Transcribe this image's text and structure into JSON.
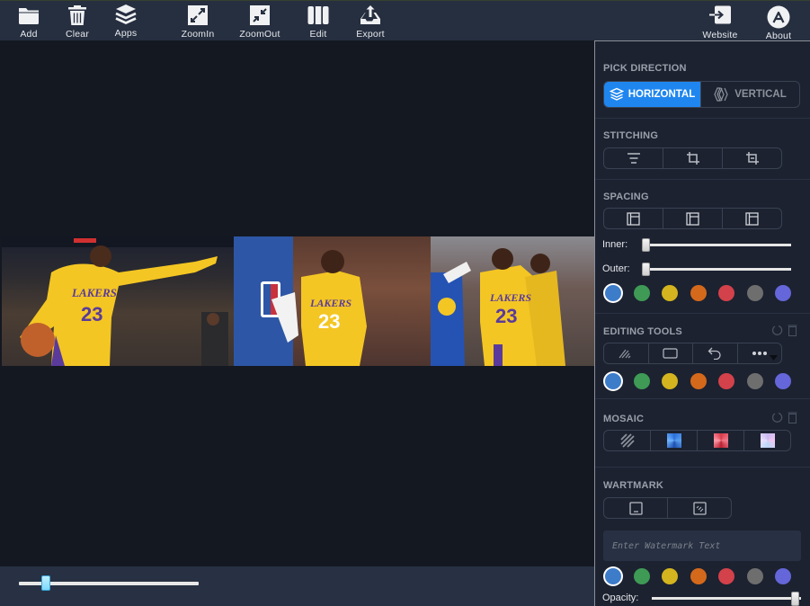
{
  "toolbar": {
    "add": "Add",
    "clear": "Clear",
    "apps": "Apps",
    "zoomin": "ZoomIn",
    "zoomout": "ZoomOut",
    "edit": "Edit",
    "export": "Export",
    "website": "Website",
    "about": "About"
  },
  "canvas": {
    "images": [
      {
        "alt": "Lakers #23 pointing with basketball"
      },
      {
        "alt": "Lakers #23 standing hands on hips"
      },
      {
        "alt": "Lakers #23 flexing with teammate #6"
      }
    ],
    "zoom_slider_value_percent": 15
  },
  "panel": {
    "pick_direction": {
      "title": "PICK DIRECTION",
      "options": [
        "HORIZONTAL",
        "VERTICAL"
      ],
      "selected": "HORIZONTAL"
    },
    "stitching": {
      "title": "STITCHING",
      "buttons": [
        "align-icon",
        "crop-icon",
        "crop-trim-icon"
      ]
    },
    "spacing": {
      "title": "SPACING",
      "buttons": [
        "layout-left-icon",
        "layout-center-icon",
        "layout-right-icon"
      ],
      "inner_label": "Inner:",
      "inner_value": 0,
      "outer_label": "Outer:",
      "outer_value": 0,
      "selected_color": "#3d7cc9"
    },
    "editing_tools": {
      "title": "EDITING TOOLS",
      "buttons": [
        "brush-icon",
        "rectangle-icon",
        "undo-icon",
        "more-icon"
      ],
      "selected_color": "#3d7cc9"
    },
    "mosaic": {
      "title": "MOSAIC",
      "buttons": [
        "hatch-pattern",
        "blue-mosaic",
        "red-mosaic",
        "pastel-mosaic"
      ]
    },
    "watermark": {
      "title": "WARTMARK",
      "buttons": [
        "text-box-icon",
        "tiled-watermark-icon"
      ],
      "placeholder": "Enter Watermark Text",
      "value": "",
      "selected_color": "#3d7cc9",
      "opacity_label": "Opacity:",
      "opacity_value": 100
    },
    "colors": [
      "#3d7cc9",
      "#3e9a55",
      "#d4b41f",
      "#d4691b",
      "#d3414a",
      "#6e6e6e",
      "#6466d9"
    ]
  },
  "accent": "#1f86f0"
}
